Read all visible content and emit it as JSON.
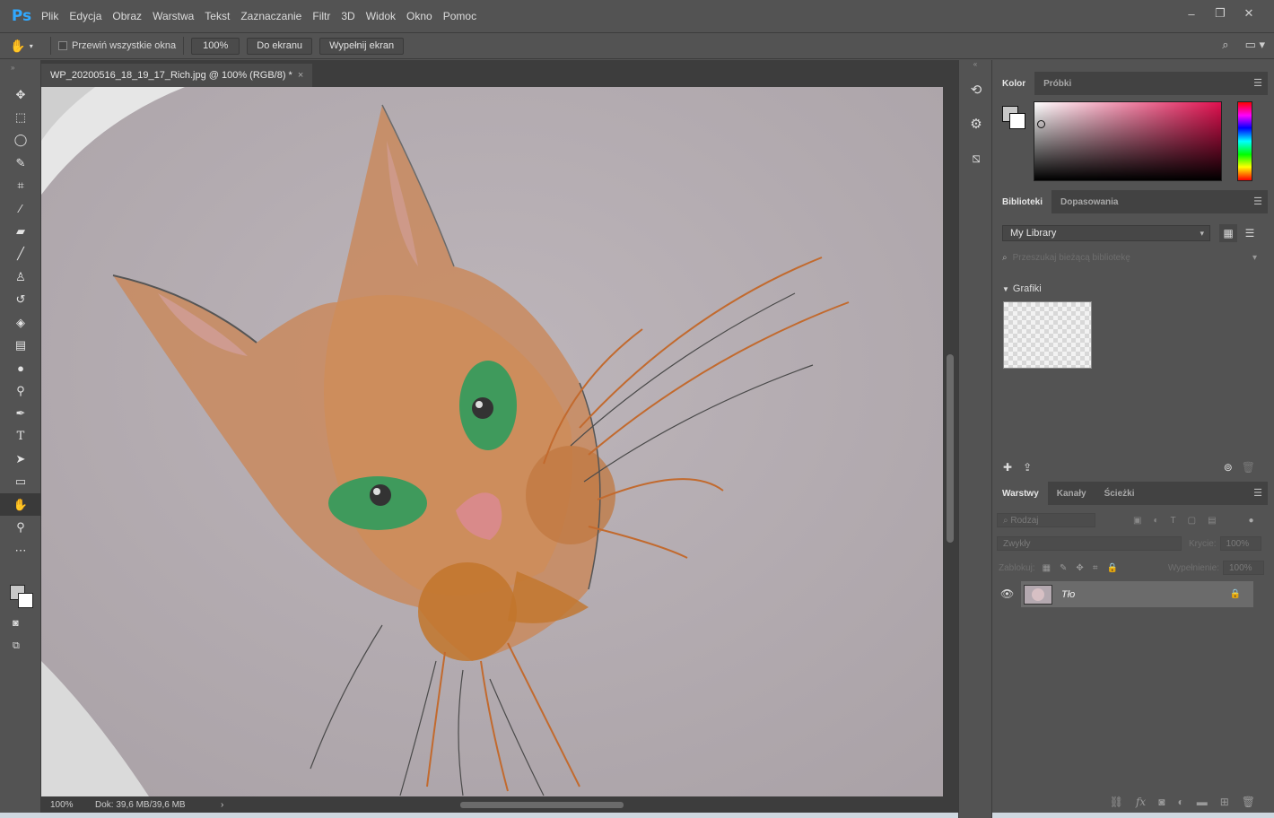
{
  "app": {
    "logo": "Ps"
  },
  "menu": [
    "Plik",
    "Edycja",
    "Obraz",
    "Warstwa",
    "Tekst",
    "Zaznaczanie",
    "Filtr",
    "3D",
    "Widok",
    "Okno",
    "Pomoc"
  ],
  "window_controls": {
    "minimize": "–",
    "restore": "❐",
    "close": "✕"
  },
  "options_bar": {
    "scroll_all_label": "Przewiń wszystkie okna",
    "zoom_value": "100%",
    "fit_screen": "Do ekranu",
    "fill_screen": "Wypełnij ekran"
  },
  "document": {
    "tab_title": "WP_20200516_18_19_17_Rich.jpg @ 100% (RGB/8) *",
    "zoom": "100%",
    "doc_size": "Dok: 39,6 MB/39,6 MB"
  },
  "color_panel": {
    "tabs": [
      "Kolor",
      "Próbki"
    ],
    "foreground": "#c8c8c8",
    "background": "#ffffff",
    "hue": "#e0104f"
  },
  "libraries_panel": {
    "tabs": [
      "Biblioteki",
      "Dopasowania"
    ],
    "library": "My Library",
    "search_placeholder": "Przeszukaj bieżącą bibliotekę",
    "section": "Grafiki"
  },
  "layers_panel": {
    "tabs": [
      "Warstwy",
      "Kanały",
      "Ścieżki"
    ],
    "filter_placeholder": "Rodzaj",
    "blend_mode": "Zwykły",
    "opacity_label": "Krycie:",
    "opacity_value": "100%",
    "lock_label": "Zablokuj:",
    "fill_label": "Wypełnienie:",
    "fill_value": "100%",
    "layers": [
      {
        "name": "Tło",
        "visible": true,
        "locked": true
      }
    ]
  },
  "tools": [
    "move-icon",
    "marquee-icon",
    "lasso-icon",
    "quick-select-icon",
    "crop-icon",
    "eyedropper-icon",
    "healing-brush-icon",
    "brush-icon",
    "clone-stamp-icon",
    "history-brush-icon",
    "eraser-icon",
    "gradient-icon",
    "blur-icon",
    "dodge-icon",
    "pen-icon",
    "type-icon",
    "path-select-icon",
    "rectangle-icon",
    "hand-icon",
    "zoom-icon",
    "more-tools-icon"
  ]
}
